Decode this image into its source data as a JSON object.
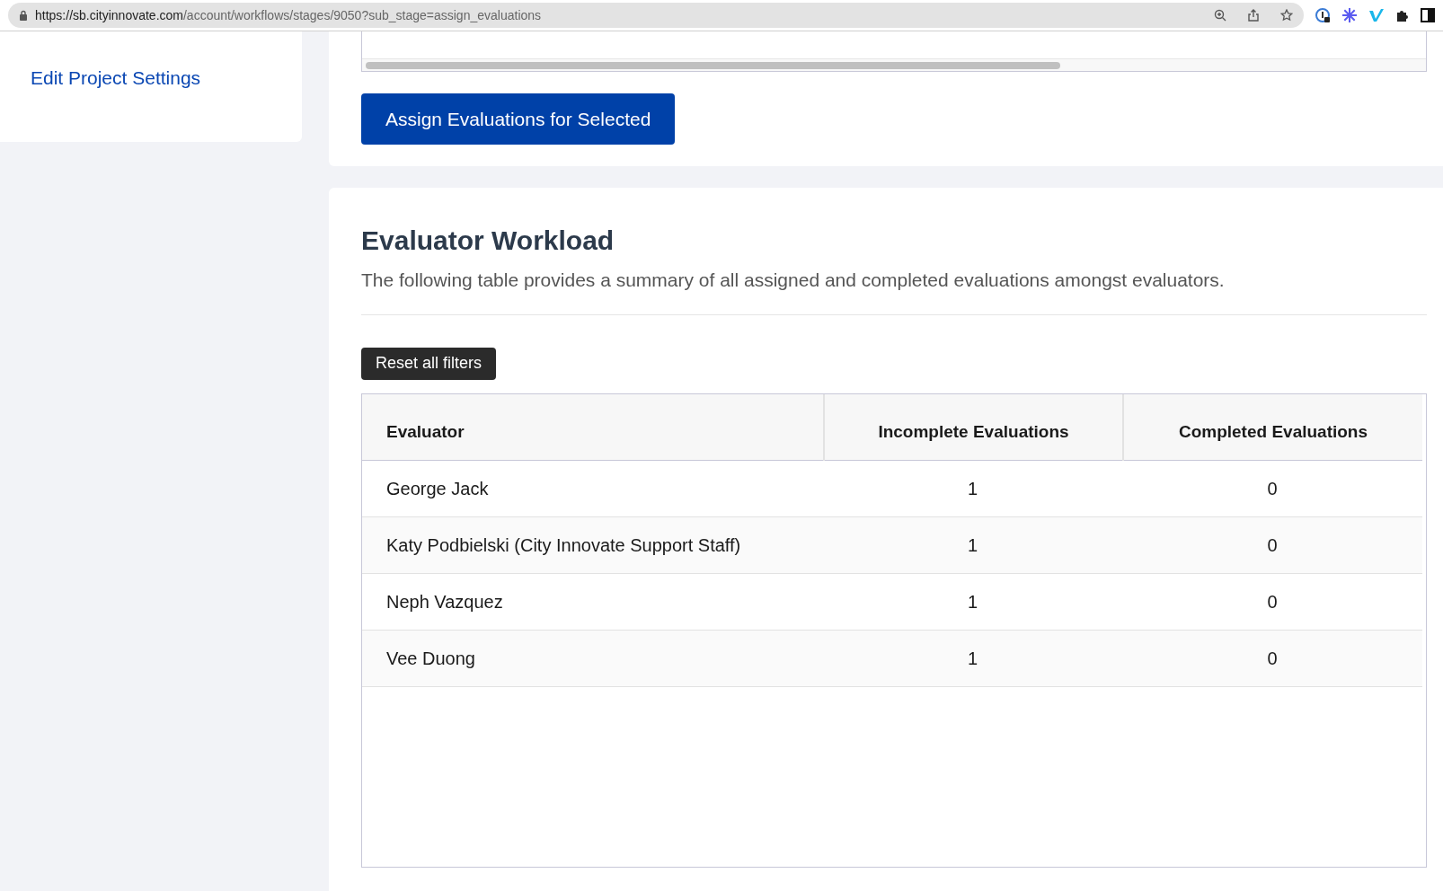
{
  "browser": {
    "url_host": "https://sb.cityinnovate.com",
    "url_path": "/account/workflows/stages/9050?sub_stage=assign_evaluations"
  },
  "sidebar": {
    "link": "Edit Project Settings"
  },
  "assign_button": "Assign Evaluations for Selected",
  "workload": {
    "title": "Evaluator Workload",
    "description": "The following table provides a summary of all assigned and completed evaluations amongst evaluators.",
    "reset_button": "Reset all filters",
    "columns": [
      "Evaluator",
      "Incomplete Evaluations",
      "Completed Evaluations"
    ],
    "rows": [
      {
        "evaluator": "George Jack",
        "incomplete": "1",
        "completed": "0"
      },
      {
        "evaluator": "Katy Podbielski (City Innovate Support Staff)",
        "incomplete": "1",
        "completed": "0"
      },
      {
        "evaluator": "Neph Vazquez",
        "incomplete": "1",
        "completed": "0"
      },
      {
        "evaluator": "Vee Duong",
        "incomplete": "1",
        "completed": "0"
      }
    ]
  }
}
